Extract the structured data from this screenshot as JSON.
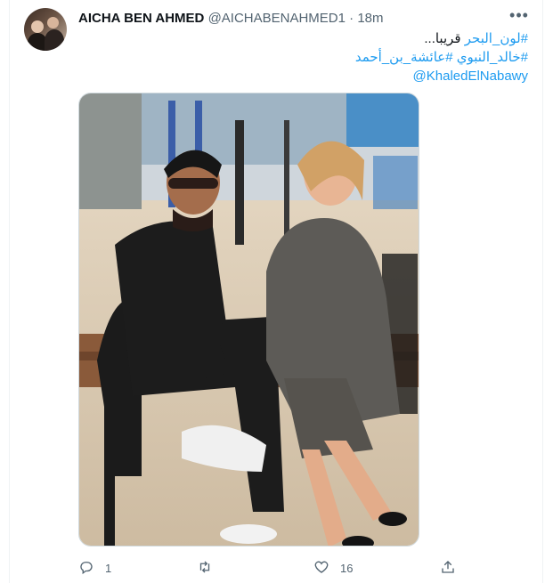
{
  "tweet": {
    "author_name": "AICHA BEN AHMED",
    "author_handle": "@AICHABENAHMED1",
    "separator": "·",
    "time": "18m",
    "more_label": "•••",
    "lines": [
      {
        "tag": "#لون_البحر",
        "plain": " قريبا..."
      },
      {
        "tag": "#خالد_النبوي #عائشة_بن_أحمد"
      },
      {
        "mention": "@KhaledElNabawy"
      }
    ],
    "actions": {
      "reply_icon": "reply-icon",
      "reply_count": "1",
      "retweet_icon": "retweet-icon",
      "like_icon": "heart-icon",
      "like_count": "16",
      "share_icon": "share-icon"
    },
    "colors": {
      "link": "#1d9bf0",
      "muted": "#536471",
      "text": "#0f1419"
    }
  }
}
